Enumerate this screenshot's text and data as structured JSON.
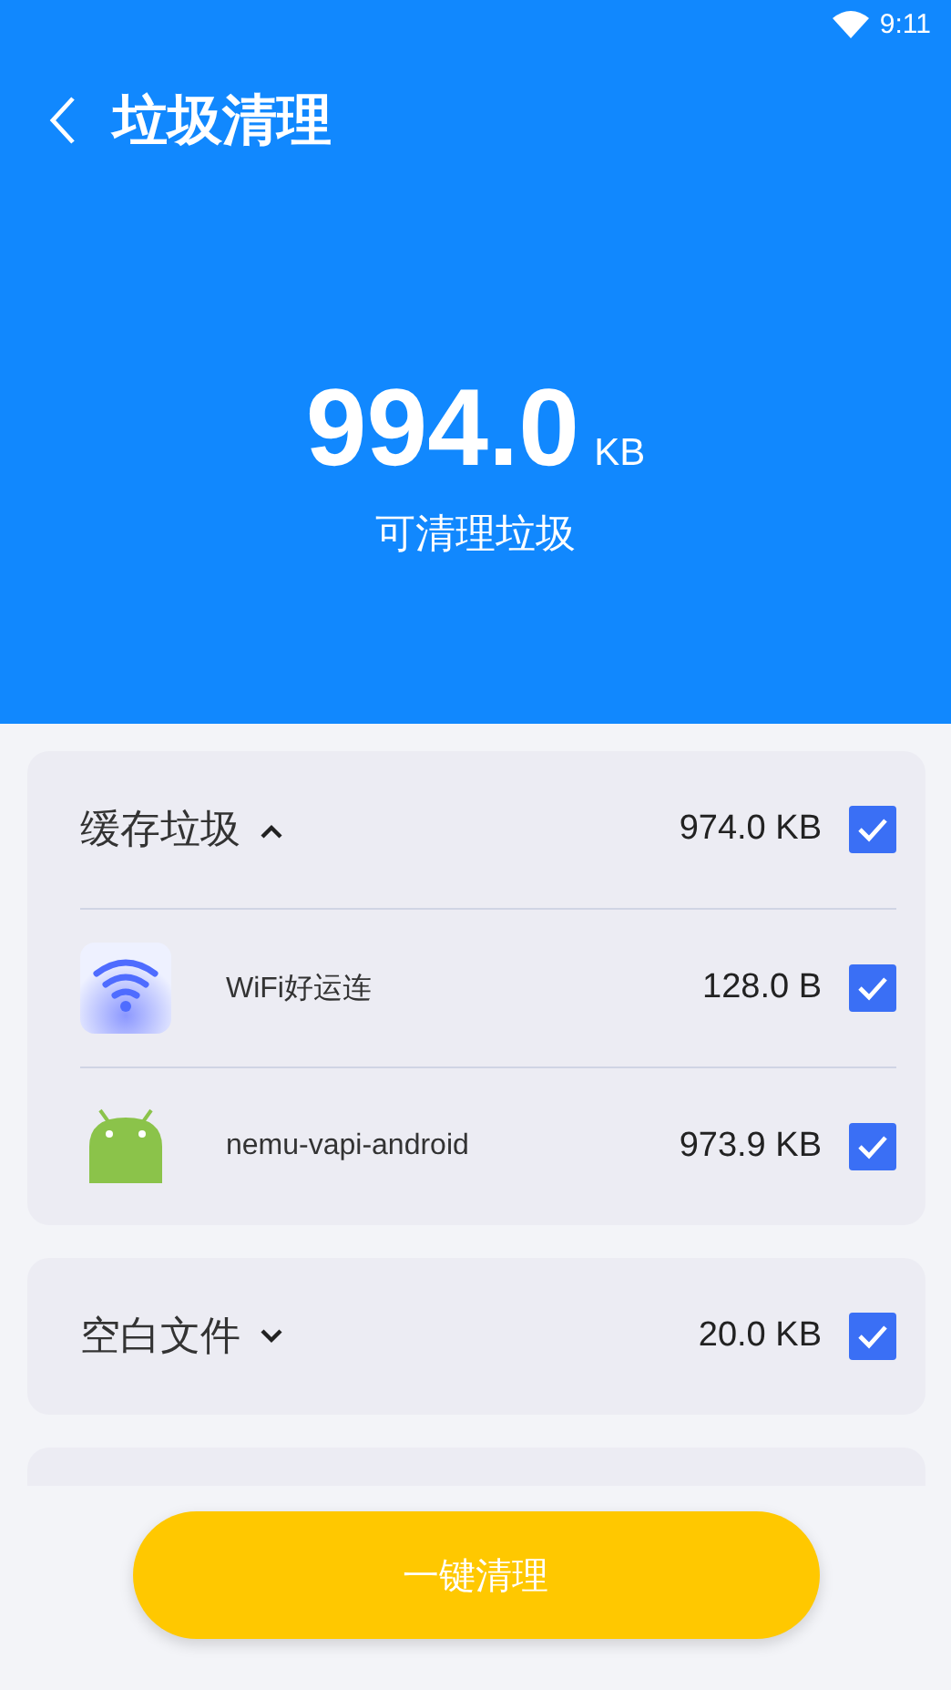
{
  "status_bar": {
    "time": "9:11"
  },
  "header": {
    "title": "垃圾清理",
    "amount": "994.0",
    "unit": "KB",
    "caption": "可清理垃圾"
  },
  "groups": [
    {
      "name": "缓存垃圾",
      "size": "974.0 KB",
      "checked": true,
      "expanded": true,
      "items": [
        {
          "kind": "wifi",
          "name": "WiFi好运连",
          "size": "128.0 B",
          "checked": true
        },
        {
          "kind": "android",
          "name": "nemu-vapi-android",
          "size": "973.9 KB",
          "checked": true
        }
      ]
    },
    {
      "name": "空白文件",
      "size": "20.0 KB",
      "checked": true,
      "expanded": false
    }
  ],
  "action_button": "一键清理"
}
